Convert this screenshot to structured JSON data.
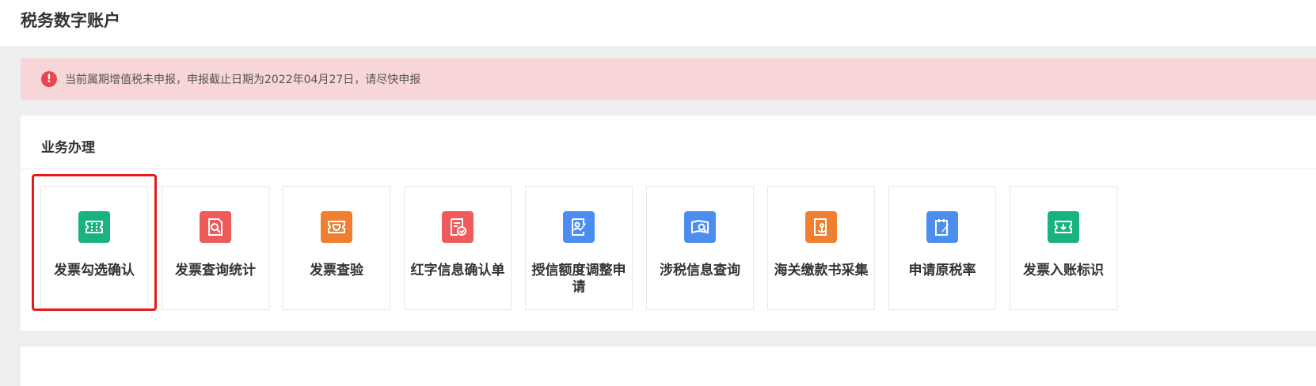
{
  "header": {
    "title": "税务数字账户"
  },
  "alert": {
    "icon": "alert-circle-icon",
    "text": "当前属期增值税未申报，申报截止日期为2022年04月27日，请尽快申报",
    "color": "#e6474f"
  },
  "business": {
    "title": "业务办理",
    "tiles": [
      {
        "label": "发票勾选确认",
        "icon": "ticket-icon",
        "color": "#19b37f"
      },
      {
        "label": "发票查询统计",
        "icon": "document-search-icon",
        "color": "#ef5b5b"
      },
      {
        "label": "发票查验",
        "icon": "shield-ticket-icon",
        "color": "#f08030"
      },
      {
        "label": "红字信息确认单",
        "icon": "document-check-icon",
        "color": "#ef5b5b"
      },
      {
        "label": "授信额度调整申请",
        "icon": "id-edit-icon",
        "color": "#4c8ef0"
      },
      {
        "label": "涉税信息查询",
        "icon": "folder-search-icon",
        "color": "#4c8ef0"
      },
      {
        "label": "海关缴款书采集",
        "icon": "document-anchor-icon",
        "color": "#f08030"
      },
      {
        "label": "申请原税率",
        "icon": "clipboard-edit-icon",
        "color": "#4c8ef0"
      },
      {
        "label": "发票入账标识",
        "icon": "ticket-download-icon",
        "color": "#19b37f"
      }
    ]
  },
  "highlight_color": "#e8191b"
}
